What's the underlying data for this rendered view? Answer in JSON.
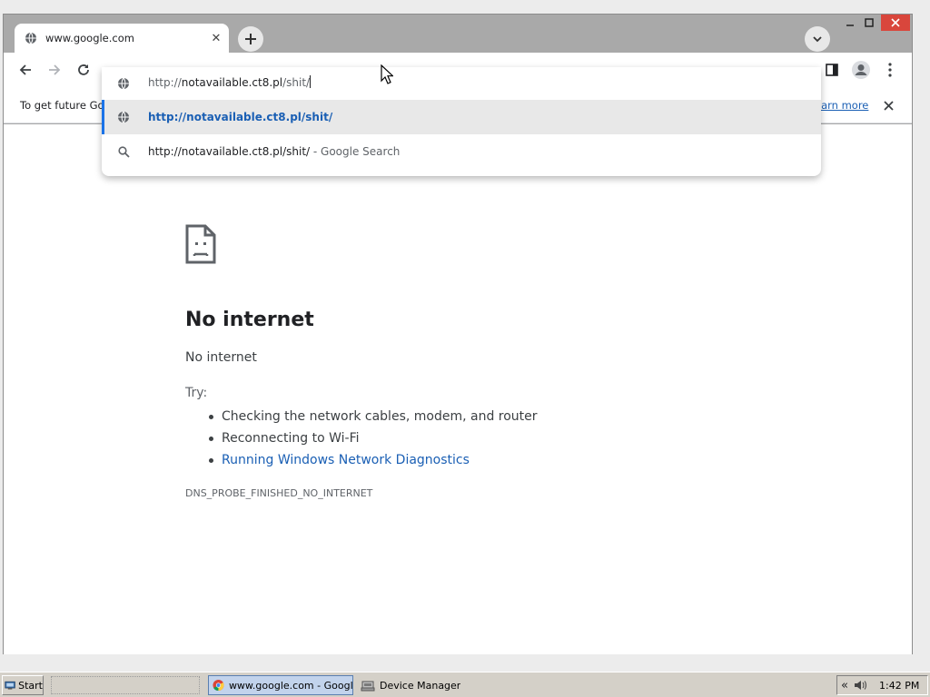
{
  "browser": {
    "tab": {
      "title": "www.google.com"
    },
    "window_controls": {
      "minimize": "–",
      "maximize": "□",
      "close": "✕"
    }
  },
  "infobar": {
    "text": "To get future Go",
    "link": "earn more"
  },
  "omnibox": {
    "input_prefix": "http://",
    "input_host": "notavailable.ct8.pl",
    "input_path": "/shit/",
    "suggestions": [
      {
        "icon": "globe-icon",
        "text": "http://notavailable.ct8.pl/shit/",
        "suffix": ""
      },
      {
        "icon": "search-icon",
        "text": "http://notavailable.ct8.pl/shit/",
        "suffix": " - Google Search"
      }
    ]
  },
  "error_page": {
    "title": "No internet",
    "subtitle": "No internet",
    "try_label": "Try:",
    "tips": [
      "Checking the network cables, modem, and router",
      "Reconnecting to Wi-Fi",
      "Running Windows Network Diagnostics"
    ],
    "code": "DNS_PROBE_FINISHED_NO_INTERNET"
  },
  "taskbar": {
    "start": "Start",
    "tasks": [
      {
        "label": "www.google.com - Googl...",
        "icon": "chrome-icon"
      },
      {
        "label": "Device Manager",
        "icon": "device-manager-icon"
      }
    ],
    "tray": {
      "arrow": "«",
      "time": "1:42 PM"
    }
  },
  "colors": {
    "accent": "#1a73e8",
    "link": "#1a5fb4",
    "close": "#d9463c"
  }
}
